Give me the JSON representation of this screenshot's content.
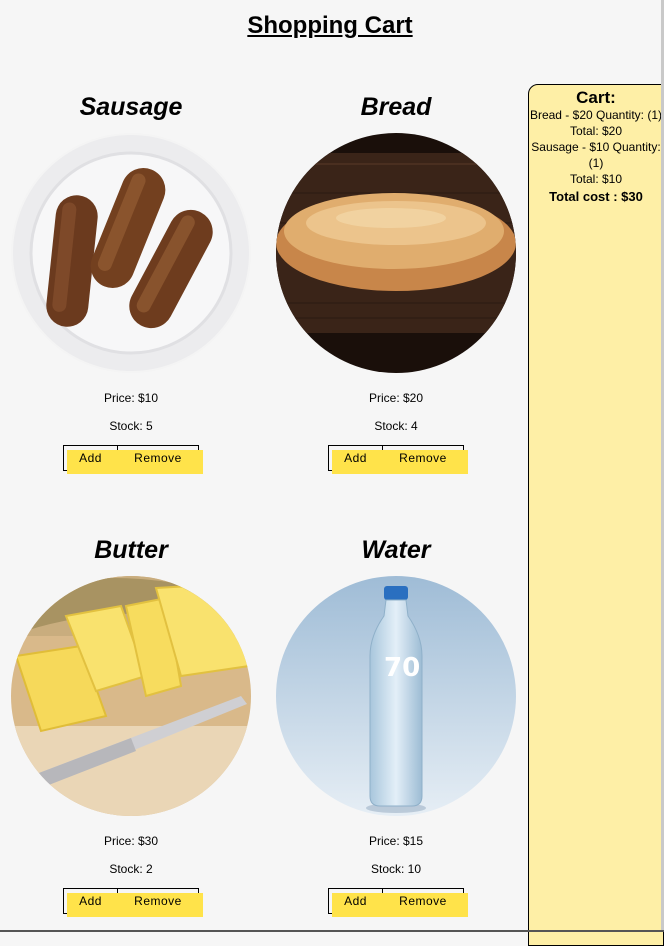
{
  "page": {
    "title": "Shopping Cart"
  },
  "products": [
    {
      "name": "Sausage",
      "price": "Price: $10",
      "stock": "Stock: 5",
      "add_label": "Add",
      "remove_label": "Remove"
    },
    {
      "name": "Bread",
      "price": "Price: $20",
      "stock": "Stock: 4",
      "add_label": "Add",
      "remove_label": "Remove"
    },
    {
      "name": "Butter",
      "price": "Price: $30",
      "stock": "Stock: 2",
      "add_label": "Add",
      "remove_label": "Remove"
    },
    {
      "name": "Water",
      "price": "Price: $15",
      "stock": "Stock: 10",
      "add_label": "Add",
      "remove_label": "Remove"
    }
  ],
  "cart": {
    "title": "Cart:",
    "items": [
      {
        "line": "Bread - $20 Quantity: (1)",
        "total": "Total: $20"
      },
      {
        "line": "Sausage - $10 Quantity: (1)",
        "total": "Total: $10"
      }
    ],
    "total_cost": "Total cost : $30"
  },
  "colors": {
    "button_highlight": "#ffe34a",
    "cart_background": "#feefa6",
    "page_background": "#f6f6f6"
  }
}
